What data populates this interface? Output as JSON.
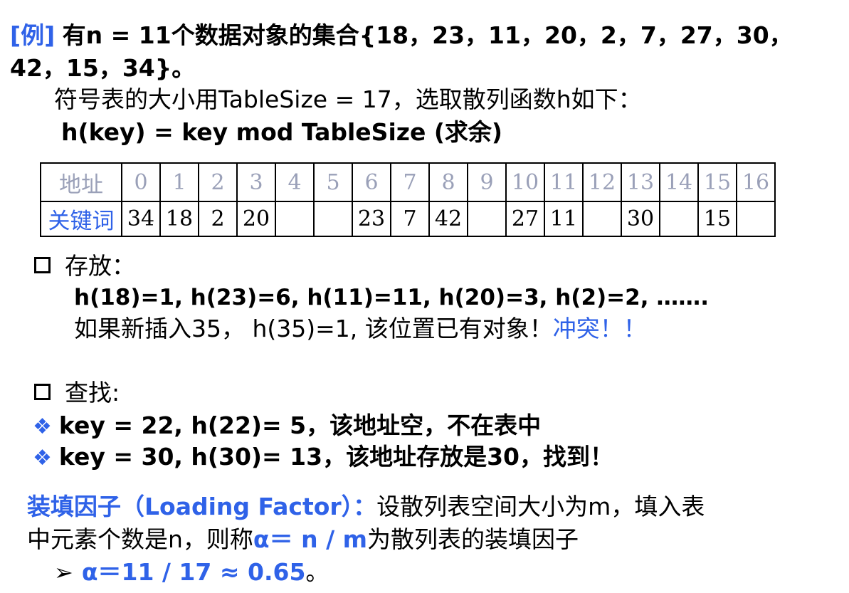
{
  "example": {
    "tag": "[例]",
    "line1": "有n = 11个数据对象的集合{18，23，11，20，2，7，27，30，",
    "line2": "42，15，34}。",
    "line3": "符号表的大小用TableSize = 17，选取散列函数h如下：",
    "line4": "h(key) = key mod TableSize    (求余)"
  },
  "table": {
    "addr_header": "地址",
    "key_header": "关键词",
    "addresses": [
      "0",
      "1",
      "2",
      "3",
      "4",
      "5",
      "6",
      "7",
      "8",
      "9",
      "10",
      "11",
      "12",
      "13",
      "14",
      "15",
      "16"
    ],
    "keys": [
      "34",
      "18",
      "2",
      "20",
      "",
      "",
      "23",
      "7",
      "42",
      "",
      "27",
      "11",
      "",
      "30",
      "",
      "15",
      ""
    ]
  },
  "store": {
    "title": "存放：",
    "line1": "h(18)=1,  h(23)=6,  h(11)=11, h(20)=3, h(2)=2, …….",
    "line2_prefix": "如果新插入35，  h(35)=1, 该位置已有对象！",
    "line2_conflict": "冲突！！"
  },
  "search": {
    "title": "查找:",
    "item1": "key = 22, h(22)= 5，该地址空，不在表中",
    "item2": "key = 30, h(30)= 13，该地址存放是30，找到！"
  },
  "loading": {
    "term": "装填因子（Loading Factor）：",
    "desc1": "设散列表空间大小为m，填入表",
    "desc2_prefix": "中元素个数是n，则称",
    "alpha_expr": "α＝ n / m",
    "desc2_suffix": "为散列表的装填因子",
    "example_value": "α＝11 / 17 ≈ 0.65",
    "example_end": "。"
  },
  "colors": {
    "accent": "#2f62e8",
    "address_gray": "#9aa0b8"
  }
}
